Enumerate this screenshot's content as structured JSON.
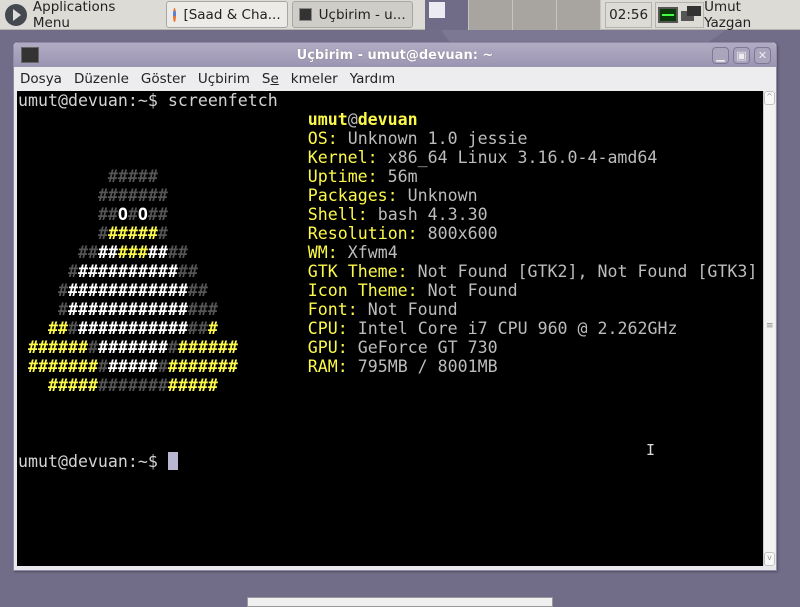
{
  "panel": {
    "app_menu": "Applications Menu",
    "tasks": [
      {
        "label": "[Saad & Cha...",
        "icon": "firefox-icon"
      },
      {
        "label": "Uçbirim - u...",
        "icon": "terminal-icon"
      }
    ],
    "clock": "02:56",
    "user": "Umut Yazgan"
  },
  "window": {
    "title": "Uçbirim - umut@devuan: ~",
    "menu": [
      "Dosya",
      "Düzenle",
      "Göster",
      "Uçbirim",
      "Sekmeler",
      "Yardım"
    ]
  },
  "terminal": {
    "prompt": "umut@devuan:~$ ",
    "command": "screenfetch",
    "header": {
      "user": "umut",
      "at": "@",
      "host": "devuan"
    },
    "info": [
      {
        "key": "OS:",
        "value": "Unknown 1.0 jessie"
      },
      {
        "key": "Kernel:",
        "value": "x86_64 Linux 3.16.0-4-amd64"
      },
      {
        "key": "Uptime:",
        "value": "56m"
      },
      {
        "key": "Packages:",
        "value": "Unknown"
      },
      {
        "key": "Shell:",
        "value": "bash 4.3.30"
      },
      {
        "key": "Resolution:",
        "value": "800x600"
      },
      {
        "key": "WM:",
        "value": "Xfwm4"
      },
      {
        "key": "GTK Theme:",
        "value": "Not Found [GTK2], Not Found [GTK3]"
      },
      {
        "key": "Icon Theme:",
        "value": "Not Found"
      },
      {
        "key": "Font:",
        "value": "Not Found"
      },
      {
        "key": "CPU:",
        "value": "Intel Core i7 CPU 960 @ 2.262GHz"
      },
      {
        "key": "GPU:",
        "value": "GeForce GT 730"
      },
      {
        "key": "RAM:",
        "value": "795MB / 8001MB"
      }
    ],
    "logo": [
      [
        9,
        [
          [
            "g",
            "#####"
          ]
        ]
      ],
      [
        8,
        [
          [
            "g",
            "#######"
          ]
        ]
      ],
      [
        8,
        [
          [
            "g",
            "##"
          ],
          [
            "w",
            "O"
          ],
          [
            "g",
            "#"
          ],
          [
            "w",
            "O"
          ],
          [
            "g",
            "##"
          ]
        ]
      ],
      [
        8,
        [
          [
            "g",
            "#"
          ],
          [
            "y",
            "#####"
          ],
          [
            "g",
            "#"
          ]
        ]
      ],
      [
        6,
        [
          [
            "g",
            "##"
          ],
          [
            "w",
            "##"
          ],
          [
            "y",
            "###"
          ],
          [
            "w",
            "##"
          ],
          [
            "g",
            "##"
          ]
        ]
      ],
      [
        5,
        [
          [
            "g",
            "#"
          ],
          [
            "w",
            "##########"
          ],
          [
            "g",
            "##"
          ]
        ]
      ],
      [
        4,
        [
          [
            "g",
            "#"
          ],
          [
            "w",
            "############"
          ],
          [
            "g",
            "##"
          ]
        ]
      ],
      [
        4,
        [
          [
            "g",
            "#"
          ],
          [
            "w",
            "############"
          ],
          [
            "g",
            "###"
          ]
        ]
      ],
      [
        3,
        [
          [
            "y",
            "##"
          ],
          [
            "g",
            "#"
          ],
          [
            "w",
            "###########"
          ],
          [
            "g",
            "##"
          ],
          [
            "y",
            "#"
          ]
        ]
      ],
      [
        1,
        [
          [
            "y",
            "######"
          ],
          [
            "g",
            "#"
          ],
          [
            "w",
            "#######"
          ],
          [
            "g",
            "#"
          ],
          [
            "y",
            "######"
          ]
        ]
      ],
      [
        1,
        [
          [
            "y",
            "#######"
          ],
          [
            "g",
            "#"
          ],
          [
            "w",
            "#####"
          ],
          [
            "g",
            "#"
          ],
          [
            "y",
            "#######"
          ]
        ]
      ],
      [
        3,
        [
          [
            "y",
            "#####"
          ],
          [
            "g",
            "#######"
          ],
          [
            "y",
            "#####"
          ]
        ]
      ]
    ]
  }
}
